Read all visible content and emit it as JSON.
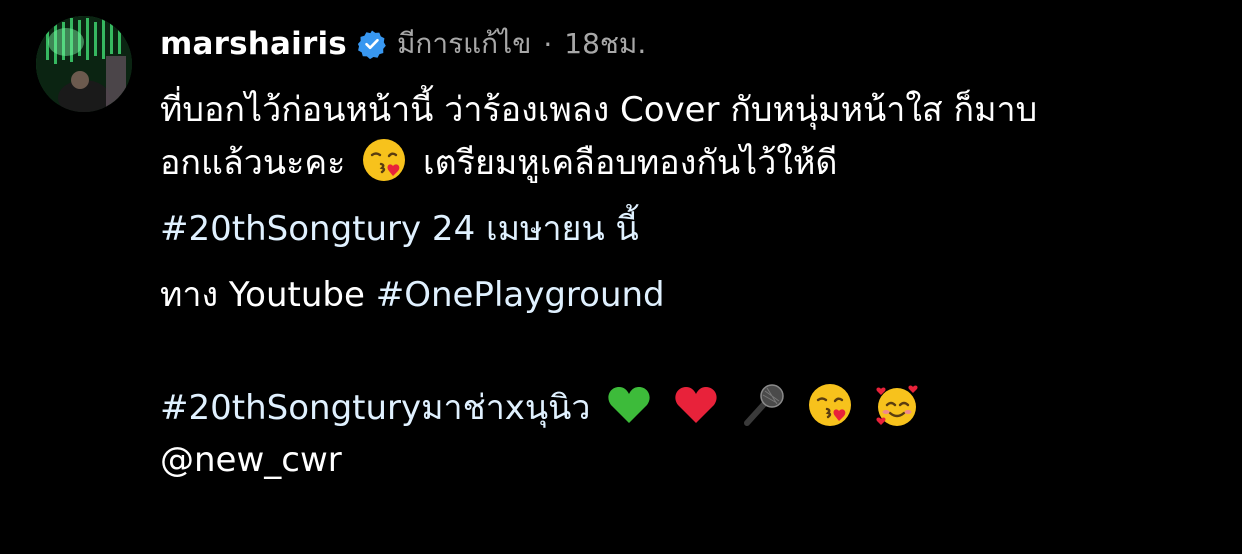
{
  "post": {
    "username": "marshairis",
    "edited_label": "มีการแก้ไข",
    "separator": "·",
    "timestamp": "18ชม.",
    "avatar_icon": "profile-avatar",
    "verified_icon": "verified-badge-icon",
    "caption": {
      "line1": "ที่บอกไว้ก่อนหน้านี้ ว่าร้องเพลง Cover กับหนุ่มหน้าใส ก็มาบ",
      "line2_a": "อกแล้วนะคะ",
      "line2_emoji": "kissing-face-icon",
      "line2_b": "เตรียมหูเคลือบทองกันไว้ให้ดี",
      "line3": "#20thSongtury 24 เมษายน นี้",
      "line4_a": "ทาง Youtube ",
      "line4_tag": "#OnePlayground",
      "line5_tag": "#20thSongturyมาช่าxนุนิว",
      "line5_emojis": [
        "green-heart-icon",
        "red-heart-icon",
        "microphone-icon",
        "kissing-face-icon",
        "smiling-face-with-hearts-icon"
      ],
      "mention": "@new_cwr"
    }
  },
  "colors": {
    "background": "#000000",
    "text": "#ffffff",
    "meta_text": "#a8a8a8",
    "hashtag": "#e0f1ff",
    "verified_blue": "#3897f0"
  }
}
